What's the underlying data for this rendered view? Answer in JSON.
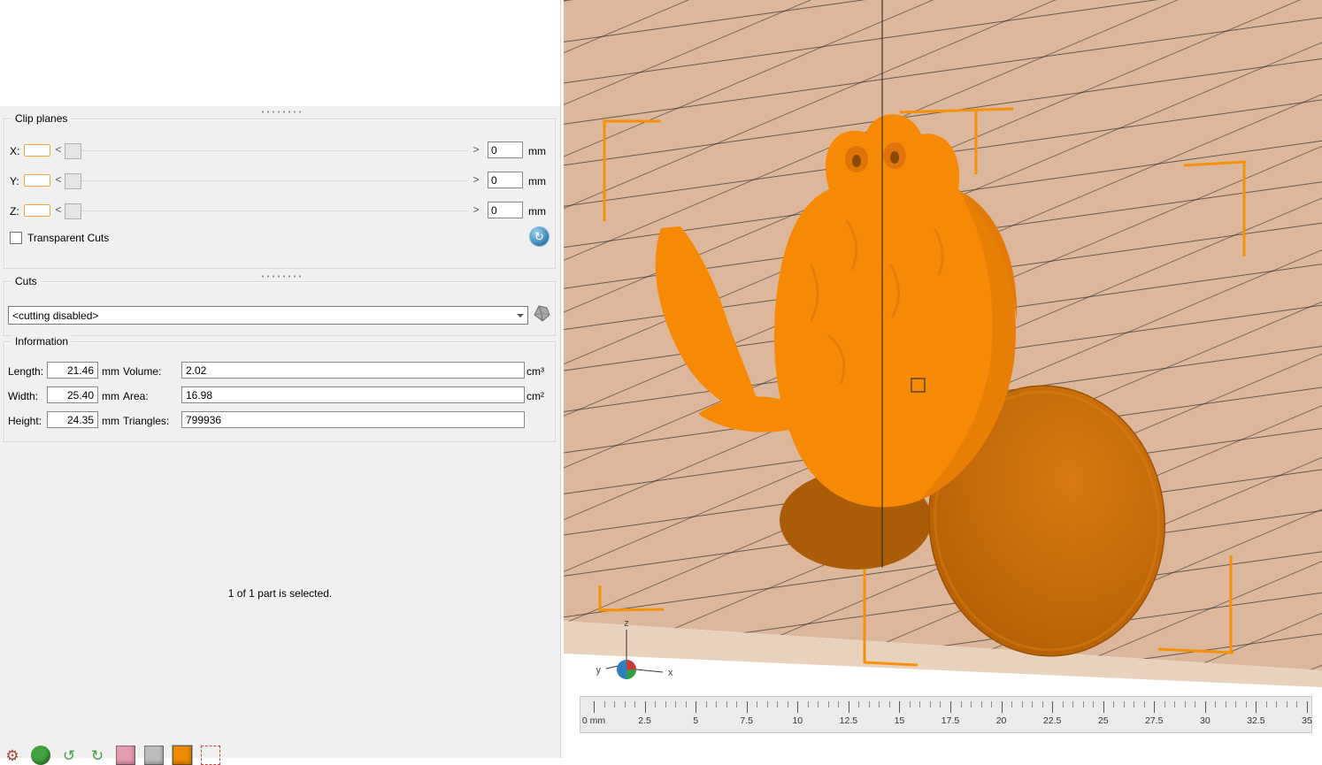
{
  "left_panel": {
    "clip_planes": {
      "title": "Clip planes",
      "left_arrow": "<",
      "right_arrow": ">",
      "axes": [
        {
          "label": "X:",
          "value": "0",
          "unit": "mm"
        },
        {
          "label": "Y:",
          "value": "0",
          "unit": "mm"
        },
        {
          "label": "Z:",
          "value": "0",
          "unit": "mm"
        }
      ],
      "transparent_cuts_label": "Transparent Cuts",
      "reset_icon_glyph": "↻"
    },
    "cuts": {
      "title": "Cuts",
      "dropdown_value": "<cutting disabled>"
    },
    "information": {
      "title": "Information",
      "fields": [
        {
          "label": "Length:",
          "value": "21.46",
          "unit": "mm"
        },
        {
          "label": "Width:",
          "value": "25.40",
          "unit": "mm"
        },
        {
          "label": "Height:",
          "value": "24.35",
          "unit": "mm"
        },
        {
          "label": "Volume:",
          "value": "2.02",
          "unit": "cm³"
        },
        {
          "label": "Area:",
          "value": "16.98",
          "unit": "cm²"
        },
        {
          "label": "Triangles:",
          "value": "799936",
          "unit": ""
        }
      ]
    },
    "selection_status": "1 of 1 part is selected.",
    "toolbar_icons": [
      {
        "name": "settings-gear-icon",
        "type": "glyph",
        "glyph": "⚙",
        "fg": "#a04434"
      },
      {
        "name": "repair-sphere-icon",
        "type": "circle",
        "glyph": "",
        "bg": "#43a33f"
      },
      {
        "name": "rotate-left-icon",
        "type": "glyph",
        "glyph": "↺",
        "fg": "#3f9f3f"
      },
      {
        "name": "rotate-right-icon",
        "type": "glyph",
        "glyph": "↻",
        "fg": "#3f9f3f"
      },
      {
        "name": "package-icon",
        "type": "square",
        "glyph": "",
        "bg": "#e59cb1"
      },
      {
        "name": "printer-icon",
        "type": "square",
        "glyph": "",
        "bg": "#bdbdbd"
      },
      {
        "name": "part-icon",
        "type": "square",
        "glyph": "",
        "bg": "#f08a00",
        "selected": true
      },
      {
        "name": "selection-cube-icon",
        "type": "dashed",
        "glyph": "",
        "fg": "#d34040"
      }
    ]
  },
  "viewport": {
    "axis_labels": {
      "x": "x",
      "y": "y",
      "z": "z"
    },
    "ruler_labels": [
      "0 mm",
      "2.5",
      "5",
      "7.5",
      "10",
      "12.5",
      "15",
      "17.5",
      "20",
      "22.5",
      "25",
      "27.5",
      "30",
      "32.5",
      "35"
    ],
    "colors": {
      "model": "#f78a05",
      "model_shade": "#e27a06",
      "cut_surface": "#ab5c06",
      "disc": "#c2690e",
      "platform": "#dcb79b",
      "platform_side": "#e8d2bd",
      "bracket": "#f59105"
    }
  }
}
